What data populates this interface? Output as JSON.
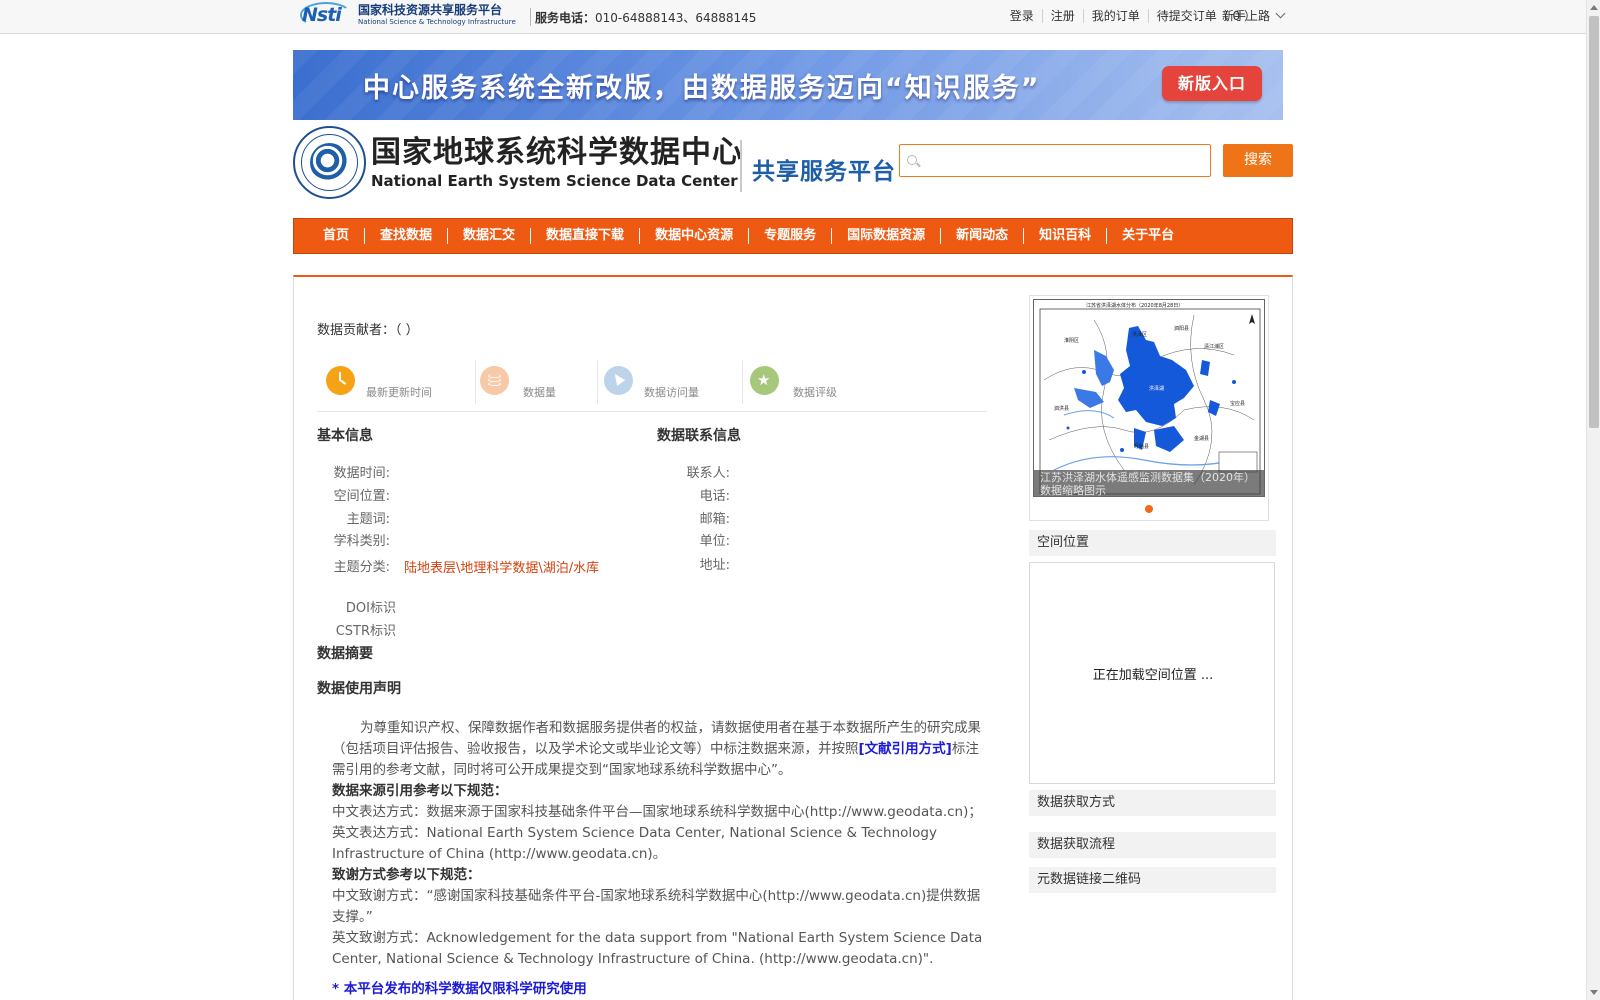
{
  "topbar": {
    "logo_cn": "国家科技资源共享服务平台",
    "logo_en": "National Science & Technology Infrastructure",
    "logo_mark": "Nsti",
    "hotline_label": "服务电话：",
    "hotline_numbers": "010-64888143、64888145",
    "links": [
      "登录",
      "注册",
      "我的订单",
      "待提交订单（ 0 ）"
    ],
    "guide": "新手上路",
    "guide_icon": "chevron-down-icon"
  },
  "banner": {
    "text": "中心服务系统全新改版，由数据服务迈向“知识服务”",
    "button": "新版入口",
    "button_color": "#e5443d"
  },
  "header": {
    "center_cn": "国家地球系统科学数据中心",
    "center_en": "National Earth System Science Data Center",
    "platform": "共享服务平台",
    "search_placeholder": "",
    "search_button": "搜索",
    "accent_color": "#ef5a13"
  },
  "nav": {
    "items": [
      "首页",
      "查找数据",
      "数据汇交",
      "数据直接下载",
      "数据中心资源",
      "专题服务",
      "国际数据资源",
      "新闻动态",
      "知识百科",
      "关于平台"
    ]
  },
  "main": {
    "contributor_label": "数据贡献者：",
    "contributor_value": "（ ）",
    "stats": [
      {
        "icon": "clock-icon",
        "label": "最新更新时间",
        "color": "#f5a214"
      },
      {
        "icon": "database-icon",
        "label": "数据量",
        "color": "#f7c9a6"
      },
      {
        "icon": "cursor-icon",
        "label": "数据访问量",
        "color": "#bcd3ea"
      },
      {
        "icon": "star-icon",
        "label": "数据评级",
        "color": "#a7c77a"
      }
    ],
    "basic_info": {
      "title": "基本信息",
      "fields": [
        {
          "label": "数据时间:",
          "value": ""
        },
        {
          "label": "空间位置:",
          "value": ""
        },
        {
          "label": "主题词:",
          "value": ""
        },
        {
          "label": "学科类别:",
          "value": ""
        },
        {
          "label": "主题分类:",
          "value": "陆地表层\\地理科学数据\\湖泊/水库"
        }
      ],
      "doi_label": "DOI标识",
      "cstr_label": "CSTR标识"
    },
    "contact_info": {
      "title": "数据联系信息",
      "fields": [
        "联系人:",
        "电话:",
        "邮箱:",
        "单位:",
        "地址:"
      ]
    },
    "abstract_title": "数据摘要",
    "usage_title": "数据使用声明",
    "statement": {
      "para1_before": "为尊重知识产权、保障数据作者和数据服务提供者的权益，请数据使用者在基于本数据所产生的研究成果（包括项目评估报告、验收报告，以及学术论文或毕业论文等）中标注数据来源，并按照",
      "para1_link": "[文献引用方式]",
      "para1_after": "标注需引用的参考文献，同时将可公开成果提交到“国家地球系统科学数据中心”。",
      "source_title": "数据来源引用参考以下规范：",
      "source_cn": "中文表达方式：数据来源于国家科技基础条件平台—国家地球系统科学数据中心(http://www.geodata.cn)；",
      "source_en": "英文表达方式：National Earth System Science Data Center, National Science & Technology Infrastructure of China (http://www.geodata.cn)。",
      "ack_title": "致谢方式参考以下规范：",
      "ack_cn": "中文致谢方式：“感谢国家科技基础条件平台-国家地球系统科学数据中心(http://www.geodata.cn)提供数据支撑。”",
      "ack_en": "英文致谢方式：Acknowledgement for the data support from \"National Earth System Science Data Center, National Science & Technology Infrastructure of China. (http://www.geodata.cn)\".",
      "partial_line": "* 本平台发布的科学数据仅限科学研究使用"
    }
  },
  "sidebar": {
    "map_title": "江苏省洪泽湖水体分布（2020年8月28日）",
    "map_caption": "江苏洪泽湖水体遥感监测数据集（2020年）数据缩略图示",
    "map_labels": [
      "洪泽区",
      "淮阴区",
      "泗阳县",
      "泗洪县",
      "盱眙县",
      "金湖县",
      "宝应县",
      "清江浦区",
      "洪泽湖"
    ],
    "spatial_title": "空间位置",
    "loading_text": "正在加载空间位置 ...",
    "access_title": "数据获取方式",
    "process_title": "数据获取流程",
    "qr_title": "元数据链接二维码"
  }
}
